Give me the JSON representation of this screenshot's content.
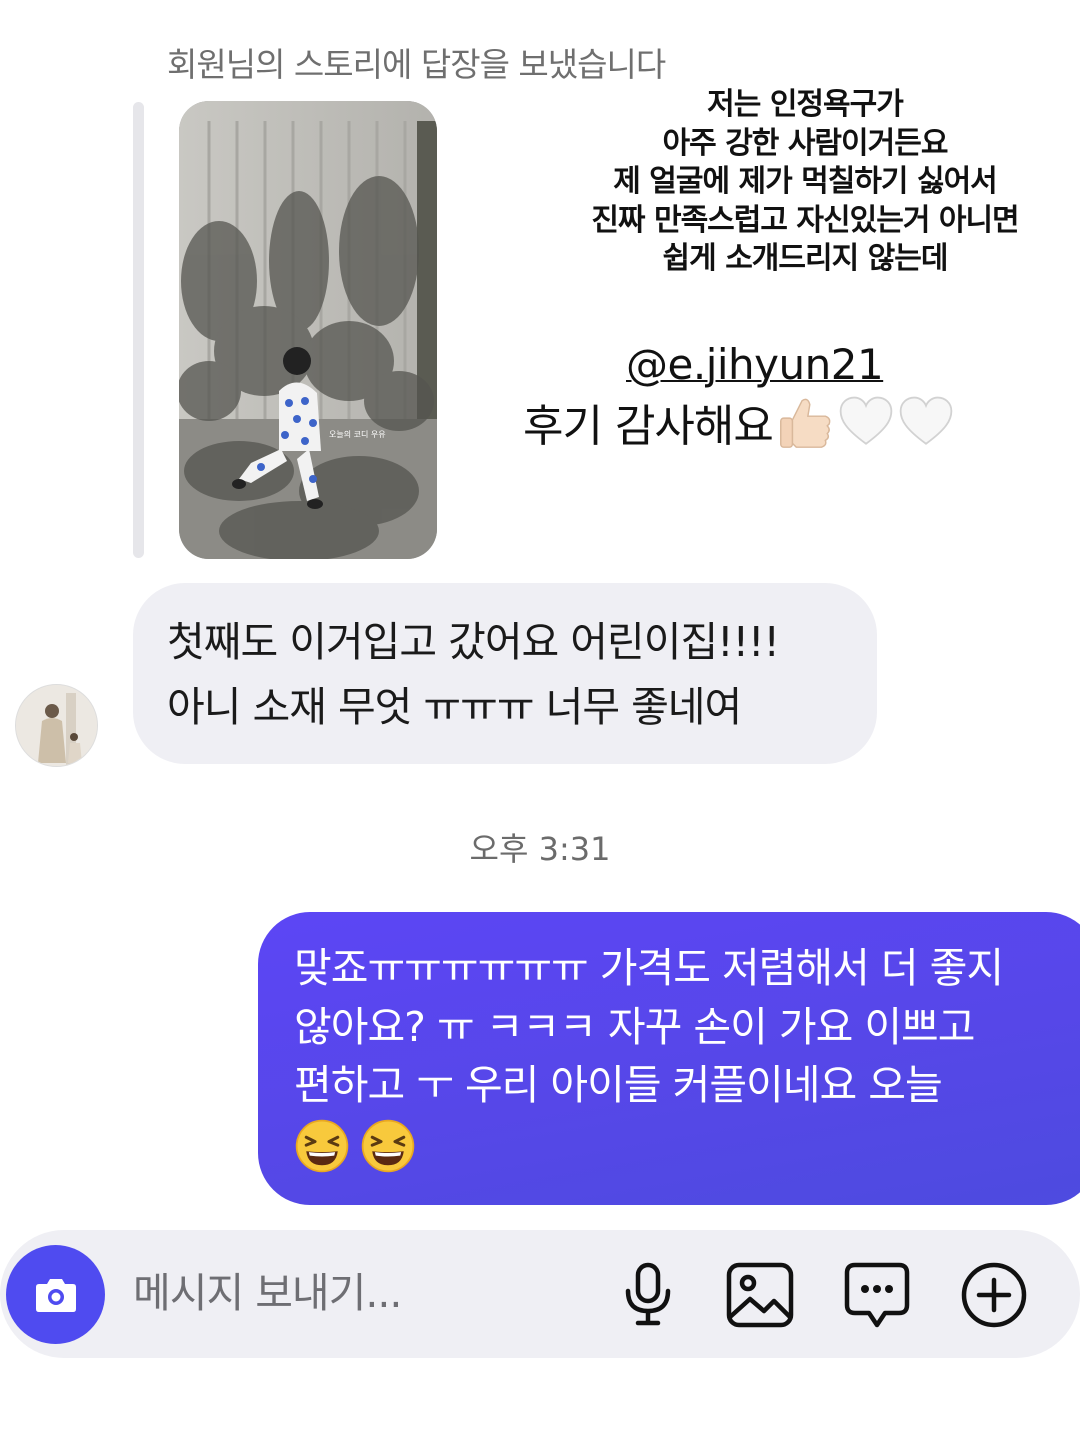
{
  "reply_header": "회원님의 스토리에 답장을 보냈습니다",
  "story": {
    "caption_lines": [
      "저는 인정욕구가",
      "아주 강한 사람이거든요",
      "제 얼굴에 제가 먹칠하기 싫어서",
      "진짜 만족스럽고 자신있는거 아니면",
      "쉽게 소개드리지 않는데"
    ],
    "mention": "@e.jihyun21",
    "thanks": "후기 감사해요",
    "thanks_emoji": [
      "thumbs-up",
      "white-heart",
      "white-heart"
    ],
    "overlay_text": "오늘의 코디 우유"
  },
  "incoming": {
    "lines": [
      "첫째도 이거입고 갔어요 어린이집!!!!",
      "아니 소재 무엇 ㅠㅠㅠ 너무 좋네여"
    ]
  },
  "timestamp": "오후 3:31",
  "outgoing": {
    "lines": [
      "맞죠ㅠㅠㅠㅠㅠㅠ 가격도 저렴해서 더 좋지",
      "않아요? ㅠ ㅋㅋㅋ 자꾸 손이 가요 이쁘고",
      "편하고 ㅜ 우리 아이들 커플이네요 오늘"
    ],
    "emoji": [
      "grinning-squinting-face",
      "grinning-squinting-face"
    ]
  },
  "composer": {
    "placeholder": "메시지 보내기...",
    "tools": [
      "microphone-icon",
      "image-icon",
      "sticker-chat-icon",
      "plus-icon"
    ]
  },
  "colors": {
    "outgoing_bubble": "#5647e8",
    "incoming_bubble": "#efeff4",
    "camera_button": "#4f4bf0",
    "composer_bg": "#efeff4"
  }
}
